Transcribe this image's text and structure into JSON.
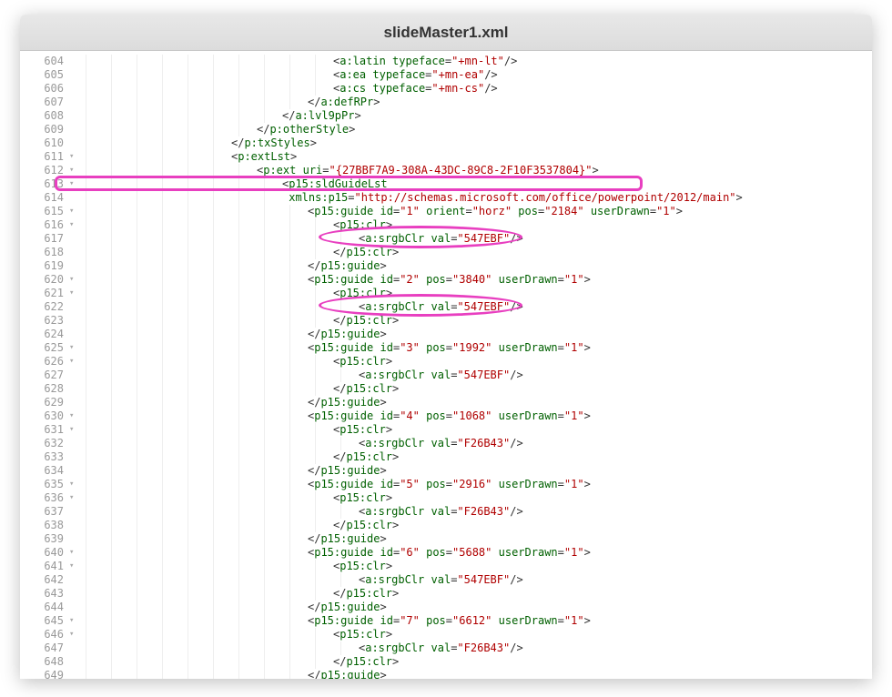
{
  "window": {
    "title": "slideMaster1.xml"
  },
  "annotations": {
    "colors": {
      "highlight": "#e83fc0"
    }
  },
  "lines": [
    {
      "n": 604,
      "fold": "",
      "indent": 10,
      "tokens": [
        [
          "sym",
          "<"
        ],
        [
          "tag",
          "a:latin"
        ],
        [
          "sym",
          " "
        ],
        [
          "attr",
          "typeface"
        ],
        [
          "sym",
          "="
        ],
        [
          "str",
          "\"+mn-lt\""
        ],
        [
          "sym",
          "/>"
        ]
      ]
    },
    {
      "n": 605,
      "fold": "",
      "indent": 10,
      "tokens": [
        [
          "sym",
          "<"
        ],
        [
          "tag",
          "a:ea"
        ],
        [
          "sym",
          " "
        ],
        [
          "attr",
          "typeface"
        ],
        [
          "sym",
          "="
        ],
        [
          "str",
          "\"+mn-ea\""
        ],
        [
          "sym",
          "/>"
        ]
      ]
    },
    {
      "n": 606,
      "fold": "",
      "indent": 10,
      "tokens": [
        [
          "sym",
          "<"
        ],
        [
          "tag",
          "a:cs"
        ],
        [
          "sym",
          " "
        ],
        [
          "attr",
          "typeface"
        ],
        [
          "sym",
          "="
        ],
        [
          "str",
          "\"+mn-cs\""
        ],
        [
          "sym",
          "/>"
        ]
      ]
    },
    {
      "n": 607,
      "fold": "",
      "indent": 9,
      "tokens": [
        [
          "sym",
          "</"
        ],
        [
          "tag",
          "a:defRPr"
        ],
        [
          "sym",
          ">"
        ]
      ]
    },
    {
      "n": 608,
      "fold": "",
      "indent": 8,
      "tokens": [
        [
          "sym",
          "</"
        ],
        [
          "tag",
          "a:lvl9pPr"
        ],
        [
          "sym",
          ">"
        ]
      ]
    },
    {
      "n": 609,
      "fold": "",
      "indent": 7,
      "tokens": [
        [
          "sym",
          "</"
        ],
        [
          "tag",
          "p:otherStyle"
        ],
        [
          "sym",
          ">"
        ]
      ]
    },
    {
      "n": 610,
      "fold": "",
      "indent": 6,
      "tokens": [
        [
          "sym",
          "</"
        ],
        [
          "tag",
          "p:txStyles"
        ],
        [
          "sym",
          ">"
        ]
      ]
    },
    {
      "n": 611,
      "fold": "▾",
      "indent": 6,
      "tokens": [
        [
          "sym",
          "<"
        ],
        [
          "tag",
          "p:extLst"
        ],
        [
          "sym",
          ">"
        ]
      ]
    },
    {
      "n": 612,
      "fold": "▾",
      "indent": 7,
      "tokens": [
        [
          "sym",
          "<"
        ],
        [
          "tag",
          "p:ext"
        ],
        [
          "sym",
          " "
        ],
        [
          "attr",
          "uri"
        ],
        [
          "sym",
          "="
        ],
        [
          "str",
          "\"{27BBF7A9-308A-43DC-89C8-2F10F3537804}\""
        ],
        [
          "sym",
          ">"
        ]
      ]
    },
    {
      "n": 613,
      "fold": "▾",
      "indent": 8,
      "tokens": [
        [
          "sym",
          "<"
        ],
        [
          "tag",
          "p15:sldGuideLst"
        ]
      ]
    },
    {
      "n": 614,
      "fold": "",
      "indent": 8,
      "tokens": [
        [
          "sym",
          " "
        ],
        [
          "attr",
          "xmlns:p15"
        ],
        [
          "sym",
          "="
        ],
        [
          "str",
          "\"http://schemas.microsoft.com/office/powerpoint/2012/main\""
        ],
        [
          "sym",
          ">"
        ]
      ]
    },
    {
      "n": 615,
      "fold": "▾",
      "indent": 9,
      "tokens": [
        [
          "sym",
          "<"
        ],
        [
          "tag",
          "p15:guide"
        ],
        [
          "sym",
          " "
        ],
        [
          "attr",
          "id"
        ],
        [
          "sym",
          "="
        ],
        [
          "str",
          "\"1\""
        ],
        [
          "sym",
          " "
        ],
        [
          "attr",
          "orient"
        ],
        [
          "sym",
          "="
        ],
        [
          "str",
          "\"horz\""
        ],
        [
          "sym",
          " "
        ],
        [
          "attr",
          "pos"
        ],
        [
          "sym",
          "="
        ],
        [
          "str",
          "\"2184\""
        ],
        [
          "sym",
          " "
        ],
        [
          "attr",
          "userDrawn"
        ],
        [
          "sym",
          "="
        ],
        [
          "str",
          "\"1\""
        ],
        [
          "sym",
          ">"
        ]
      ]
    },
    {
      "n": 616,
      "fold": "▾",
      "indent": 10,
      "tokens": [
        [
          "sym",
          "<"
        ],
        [
          "tag",
          "p15:clr"
        ],
        [
          "sym",
          ">"
        ]
      ]
    },
    {
      "n": 617,
      "fold": "",
      "indent": 11,
      "tokens": [
        [
          "sym",
          "<"
        ],
        [
          "tag",
          "a:srgbClr"
        ],
        [
          "sym",
          " "
        ],
        [
          "attr",
          "val"
        ],
        [
          "sym",
          "="
        ],
        [
          "str",
          "\"547EBF\""
        ],
        [
          "sym",
          "/>"
        ]
      ]
    },
    {
      "n": 618,
      "fold": "",
      "indent": 10,
      "tokens": [
        [
          "sym",
          "</"
        ],
        [
          "tag",
          "p15:clr"
        ],
        [
          "sym",
          ">"
        ]
      ]
    },
    {
      "n": 619,
      "fold": "",
      "indent": 9,
      "tokens": [
        [
          "sym",
          "</"
        ],
        [
          "tag",
          "p15:guide"
        ],
        [
          "sym",
          ">"
        ]
      ]
    },
    {
      "n": 620,
      "fold": "▾",
      "indent": 9,
      "tokens": [
        [
          "sym",
          "<"
        ],
        [
          "tag",
          "p15:guide"
        ],
        [
          "sym",
          " "
        ],
        [
          "attr",
          "id"
        ],
        [
          "sym",
          "="
        ],
        [
          "str",
          "\"2\""
        ],
        [
          "sym",
          " "
        ],
        [
          "attr",
          "pos"
        ],
        [
          "sym",
          "="
        ],
        [
          "str",
          "\"3840\""
        ],
        [
          "sym",
          " "
        ],
        [
          "attr",
          "userDrawn"
        ],
        [
          "sym",
          "="
        ],
        [
          "str",
          "\"1\""
        ],
        [
          "sym",
          ">"
        ]
      ]
    },
    {
      "n": 621,
      "fold": "▾",
      "indent": 10,
      "tokens": [
        [
          "sym",
          "<"
        ],
        [
          "tag",
          "p15:clr"
        ],
        [
          "sym",
          ">"
        ]
      ]
    },
    {
      "n": 622,
      "fold": "",
      "indent": 11,
      "tokens": [
        [
          "sym",
          "<"
        ],
        [
          "tag",
          "a:srgbClr"
        ],
        [
          "sym",
          " "
        ],
        [
          "attr",
          "val"
        ],
        [
          "sym",
          "="
        ],
        [
          "str",
          "\"547EBF\""
        ],
        [
          "sym",
          "/>"
        ]
      ]
    },
    {
      "n": 623,
      "fold": "",
      "indent": 10,
      "tokens": [
        [
          "sym",
          "</"
        ],
        [
          "tag",
          "p15:clr"
        ],
        [
          "sym",
          ">"
        ]
      ]
    },
    {
      "n": 624,
      "fold": "",
      "indent": 9,
      "tokens": [
        [
          "sym",
          "</"
        ],
        [
          "tag",
          "p15:guide"
        ],
        [
          "sym",
          ">"
        ]
      ]
    },
    {
      "n": 625,
      "fold": "▾",
      "indent": 9,
      "tokens": [
        [
          "sym",
          "<"
        ],
        [
          "tag",
          "p15:guide"
        ],
        [
          "sym",
          " "
        ],
        [
          "attr",
          "id"
        ],
        [
          "sym",
          "="
        ],
        [
          "str",
          "\"3\""
        ],
        [
          "sym",
          " "
        ],
        [
          "attr",
          "pos"
        ],
        [
          "sym",
          "="
        ],
        [
          "str",
          "\"1992\""
        ],
        [
          "sym",
          " "
        ],
        [
          "attr",
          "userDrawn"
        ],
        [
          "sym",
          "="
        ],
        [
          "str",
          "\"1\""
        ],
        [
          "sym",
          ">"
        ]
      ]
    },
    {
      "n": 626,
      "fold": "▾",
      "indent": 10,
      "tokens": [
        [
          "sym",
          "<"
        ],
        [
          "tag",
          "p15:clr"
        ],
        [
          "sym",
          ">"
        ]
      ]
    },
    {
      "n": 627,
      "fold": "",
      "indent": 11,
      "tokens": [
        [
          "sym",
          "<"
        ],
        [
          "tag",
          "a:srgbClr"
        ],
        [
          "sym",
          " "
        ],
        [
          "attr",
          "val"
        ],
        [
          "sym",
          "="
        ],
        [
          "str",
          "\"547EBF\""
        ],
        [
          "sym",
          "/>"
        ]
      ]
    },
    {
      "n": 628,
      "fold": "",
      "indent": 10,
      "tokens": [
        [
          "sym",
          "</"
        ],
        [
          "tag",
          "p15:clr"
        ],
        [
          "sym",
          ">"
        ]
      ]
    },
    {
      "n": 629,
      "fold": "",
      "indent": 9,
      "tokens": [
        [
          "sym",
          "</"
        ],
        [
          "tag",
          "p15:guide"
        ],
        [
          "sym",
          ">"
        ]
      ]
    },
    {
      "n": 630,
      "fold": "▾",
      "indent": 9,
      "tokens": [
        [
          "sym",
          "<"
        ],
        [
          "tag",
          "p15:guide"
        ],
        [
          "sym",
          " "
        ],
        [
          "attr",
          "id"
        ],
        [
          "sym",
          "="
        ],
        [
          "str",
          "\"4\""
        ],
        [
          "sym",
          " "
        ],
        [
          "attr",
          "pos"
        ],
        [
          "sym",
          "="
        ],
        [
          "str",
          "\"1068\""
        ],
        [
          "sym",
          " "
        ],
        [
          "attr",
          "userDrawn"
        ],
        [
          "sym",
          "="
        ],
        [
          "str",
          "\"1\""
        ],
        [
          "sym",
          ">"
        ]
      ]
    },
    {
      "n": 631,
      "fold": "▾",
      "indent": 10,
      "tokens": [
        [
          "sym",
          "<"
        ],
        [
          "tag",
          "p15:clr"
        ],
        [
          "sym",
          ">"
        ]
      ]
    },
    {
      "n": 632,
      "fold": "",
      "indent": 11,
      "tokens": [
        [
          "sym",
          "<"
        ],
        [
          "tag",
          "a:srgbClr"
        ],
        [
          "sym",
          " "
        ],
        [
          "attr",
          "val"
        ],
        [
          "sym",
          "="
        ],
        [
          "str",
          "\"F26B43\""
        ],
        [
          "sym",
          "/>"
        ]
      ]
    },
    {
      "n": 633,
      "fold": "",
      "indent": 10,
      "tokens": [
        [
          "sym",
          "</"
        ],
        [
          "tag",
          "p15:clr"
        ],
        [
          "sym",
          ">"
        ]
      ]
    },
    {
      "n": 634,
      "fold": "",
      "indent": 9,
      "tokens": [
        [
          "sym",
          "</"
        ],
        [
          "tag",
          "p15:guide"
        ],
        [
          "sym",
          ">"
        ]
      ]
    },
    {
      "n": 635,
      "fold": "▾",
      "indent": 9,
      "tokens": [
        [
          "sym",
          "<"
        ],
        [
          "tag",
          "p15:guide"
        ],
        [
          "sym",
          " "
        ],
        [
          "attr",
          "id"
        ],
        [
          "sym",
          "="
        ],
        [
          "str",
          "\"5\""
        ],
        [
          "sym",
          " "
        ],
        [
          "attr",
          "pos"
        ],
        [
          "sym",
          "="
        ],
        [
          "str",
          "\"2916\""
        ],
        [
          "sym",
          " "
        ],
        [
          "attr",
          "userDrawn"
        ],
        [
          "sym",
          "="
        ],
        [
          "str",
          "\"1\""
        ],
        [
          "sym",
          ">"
        ]
      ]
    },
    {
      "n": 636,
      "fold": "▾",
      "indent": 10,
      "tokens": [
        [
          "sym",
          "<"
        ],
        [
          "tag",
          "p15:clr"
        ],
        [
          "sym",
          ">"
        ]
      ]
    },
    {
      "n": 637,
      "fold": "",
      "indent": 11,
      "tokens": [
        [
          "sym",
          "<"
        ],
        [
          "tag",
          "a:srgbClr"
        ],
        [
          "sym",
          " "
        ],
        [
          "attr",
          "val"
        ],
        [
          "sym",
          "="
        ],
        [
          "str",
          "\"F26B43\""
        ],
        [
          "sym",
          "/>"
        ]
      ]
    },
    {
      "n": 638,
      "fold": "",
      "indent": 10,
      "tokens": [
        [
          "sym",
          "</"
        ],
        [
          "tag",
          "p15:clr"
        ],
        [
          "sym",
          ">"
        ]
      ]
    },
    {
      "n": 639,
      "fold": "",
      "indent": 9,
      "tokens": [
        [
          "sym",
          "</"
        ],
        [
          "tag",
          "p15:guide"
        ],
        [
          "sym",
          ">"
        ]
      ]
    },
    {
      "n": 640,
      "fold": "▾",
      "indent": 9,
      "tokens": [
        [
          "sym",
          "<"
        ],
        [
          "tag",
          "p15:guide"
        ],
        [
          "sym",
          " "
        ],
        [
          "attr",
          "id"
        ],
        [
          "sym",
          "="
        ],
        [
          "str",
          "\"6\""
        ],
        [
          "sym",
          " "
        ],
        [
          "attr",
          "pos"
        ],
        [
          "sym",
          "="
        ],
        [
          "str",
          "\"5688\""
        ],
        [
          "sym",
          " "
        ],
        [
          "attr",
          "userDrawn"
        ],
        [
          "sym",
          "="
        ],
        [
          "str",
          "\"1\""
        ],
        [
          "sym",
          ">"
        ]
      ]
    },
    {
      "n": 641,
      "fold": "▾",
      "indent": 10,
      "tokens": [
        [
          "sym",
          "<"
        ],
        [
          "tag",
          "p15:clr"
        ],
        [
          "sym",
          ">"
        ]
      ]
    },
    {
      "n": 642,
      "fold": "",
      "indent": 11,
      "tokens": [
        [
          "sym",
          "<"
        ],
        [
          "tag",
          "a:srgbClr"
        ],
        [
          "sym",
          " "
        ],
        [
          "attr",
          "val"
        ],
        [
          "sym",
          "="
        ],
        [
          "str",
          "\"547EBF\""
        ],
        [
          "sym",
          "/>"
        ]
      ]
    },
    {
      "n": 643,
      "fold": "",
      "indent": 10,
      "tokens": [
        [
          "sym",
          "</"
        ],
        [
          "tag",
          "p15:clr"
        ],
        [
          "sym",
          ">"
        ]
      ]
    },
    {
      "n": 644,
      "fold": "",
      "indent": 9,
      "tokens": [
        [
          "sym",
          "</"
        ],
        [
          "tag",
          "p15:guide"
        ],
        [
          "sym",
          ">"
        ]
      ]
    },
    {
      "n": 645,
      "fold": "▾",
      "indent": 9,
      "tokens": [
        [
          "sym",
          "<"
        ],
        [
          "tag",
          "p15:guide"
        ],
        [
          "sym",
          " "
        ],
        [
          "attr",
          "id"
        ],
        [
          "sym",
          "="
        ],
        [
          "str",
          "\"7\""
        ],
        [
          "sym",
          " "
        ],
        [
          "attr",
          "pos"
        ],
        [
          "sym",
          "="
        ],
        [
          "str",
          "\"6612\""
        ],
        [
          "sym",
          " "
        ],
        [
          "attr",
          "userDrawn"
        ],
        [
          "sym",
          "="
        ],
        [
          "str",
          "\"1\""
        ],
        [
          "sym",
          ">"
        ]
      ]
    },
    {
      "n": 646,
      "fold": "▾",
      "indent": 10,
      "tokens": [
        [
          "sym",
          "<"
        ],
        [
          "tag",
          "p15:clr"
        ],
        [
          "sym",
          ">"
        ]
      ]
    },
    {
      "n": 647,
      "fold": "",
      "indent": 11,
      "tokens": [
        [
          "sym",
          "<"
        ],
        [
          "tag",
          "a:srgbClr"
        ],
        [
          "sym",
          " "
        ],
        [
          "attr",
          "val"
        ],
        [
          "sym",
          "="
        ],
        [
          "str",
          "\"F26B43\""
        ],
        [
          "sym",
          "/>"
        ]
      ]
    },
    {
      "n": 648,
      "fold": "",
      "indent": 10,
      "tokens": [
        [
          "sym",
          "</"
        ],
        [
          "tag",
          "p15:clr"
        ],
        [
          "sym",
          ">"
        ]
      ]
    },
    {
      "n": 649,
      "fold": "",
      "indent": 9,
      "tokens": [
        [
          "sym",
          "</"
        ],
        [
          "tag",
          "p15:guide"
        ],
        [
          "sym",
          ">"
        ]
      ]
    }
  ]
}
